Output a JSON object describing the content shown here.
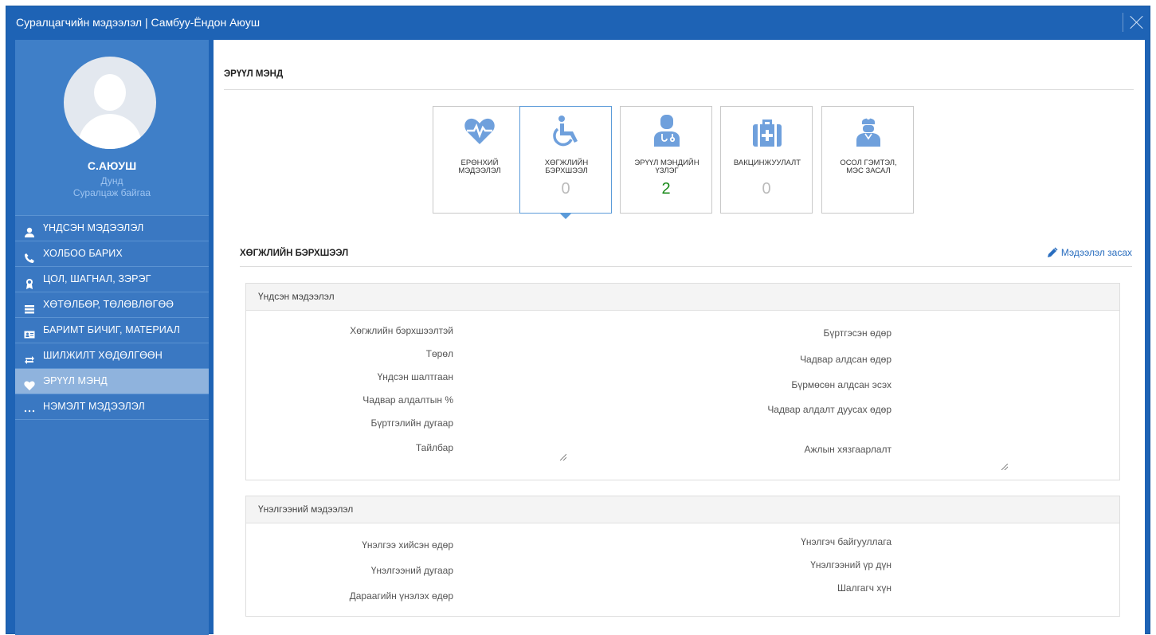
{
  "window": {
    "title": "Суралцагчийн мэдээлэл | Самбуу-Ёндон Аюуш"
  },
  "profile": {
    "name": "С.АЮУШ",
    "level": "Дунд",
    "status": "Суралцаж байгаа"
  },
  "sidebar": {
    "items": [
      {
        "label": "ҮНДСЭН МЭДЭЭЛЭЛ",
        "icon": "user-icon"
      },
      {
        "label": "ХОЛБОО БАРИХ",
        "icon": "phone-icon"
      },
      {
        "label": "ЦОЛ, ШАГНАЛ, ЗЭРЭГ",
        "icon": "award-icon"
      },
      {
        "label": "ХӨТӨЛБӨР, ТӨЛӨВЛӨГӨӨ",
        "icon": "stack-icon"
      },
      {
        "label": "БАРИМТ БИЧИГ, МАТЕРИАЛ",
        "icon": "id-card-icon"
      },
      {
        "label": "ШИЛЖИЛТ ХӨДӨЛГӨӨН",
        "icon": "transfer-icon"
      },
      {
        "label": "ЭРҮҮЛ МЭНД",
        "icon": "heart-icon",
        "active": true
      },
      {
        "label": "НЭМЭЛТ МЭДЭЭЛЭЛ",
        "icon": "ellipsis-icon"
      }
    ]
  },
  "main": {
    "section_title": "ЭРҮҮЛ МЭНД",
    "cards": [
      {
        "label_1": "ЕРӨНХИЙ",
        "label_2": "МЭДЭЭЛЭЛ",
        "count": "",
        "icon": "heartbeat-icon"
      },
      {
        "label_1": "ХӨГЖЛИЙН",
        "label_2": "БЭРХШЭЭЛ",
        "count": "0",
        "icon": "wheelchair-icon",
        "selected": true
      },
      {
        "label_1": "ЭРҮҮЛ МЭНДИЙН",
        "label_2": "ҮЗЛЭГ",
        "count": "2",
        "icon": "doctor-icon"
      },
      {
        "label_1": "ВАКЦИНЖУУЛАЛТ",
        "label_2": "",
        "count": "0",
        "icon": "medkit-icon"
      },
      {
        "label_1": "ОСОЛ ГЭМТЭЛ,",
        "label_2": "МЭС ЗАСАЛ",
        "count": "",
        "icon": "surgeon-icon"
      }
    ],
    "sub_title": "ХӨГЖЛИЙН БЭРХШЭЭЛ",
    "edit_label": "Мэдээлэл засах",
    "panel_basic": {
      "title": "Үндсэн мэдээлэл",
      "left_fields": [
        "Хөгжлийн бэрхшээлтэй",
        "Төрөл",
        "Үндсэн шалтгаан",
        "Чадвар алдалтын %",
        "Бүртгэлийн дугаар",
        "Тайлбар"
      ],
      "right_fields": [
        "Бүртгэсэн өдөр",
        "Чадвар алдсан өдөр",
        "Бүрмөсөн алдсан эсэх",
        "Чадвар алдалт дуусах өдөр",
        "Ажлын хязгаарлалт"
      ]
    },
    "panel_eval": {
      "title": "Үнэлгээний мэдээлэл",
      "left_fields": [
        "Үнэлгээ хийсэн өдөр",
        "Үнэлгээний дугаар",
        "Дараагийн үнэлэх өдөр"
      ],
      "right_fields": [
        "Үнэлгэч байгууллага",
        "Үнэлгээний үр дүн",
        "Шалгагч хүн"
      ]
    }
  },
  "colors": {
    "window_blue": "#1e63b5",
    "sidebar_blue": "#3a78c2",
    "active_item": "#8fb3dd",
    "icon_blue": "#6fa0dc",
    "count_green": "#1a8a1a"
  }
}
